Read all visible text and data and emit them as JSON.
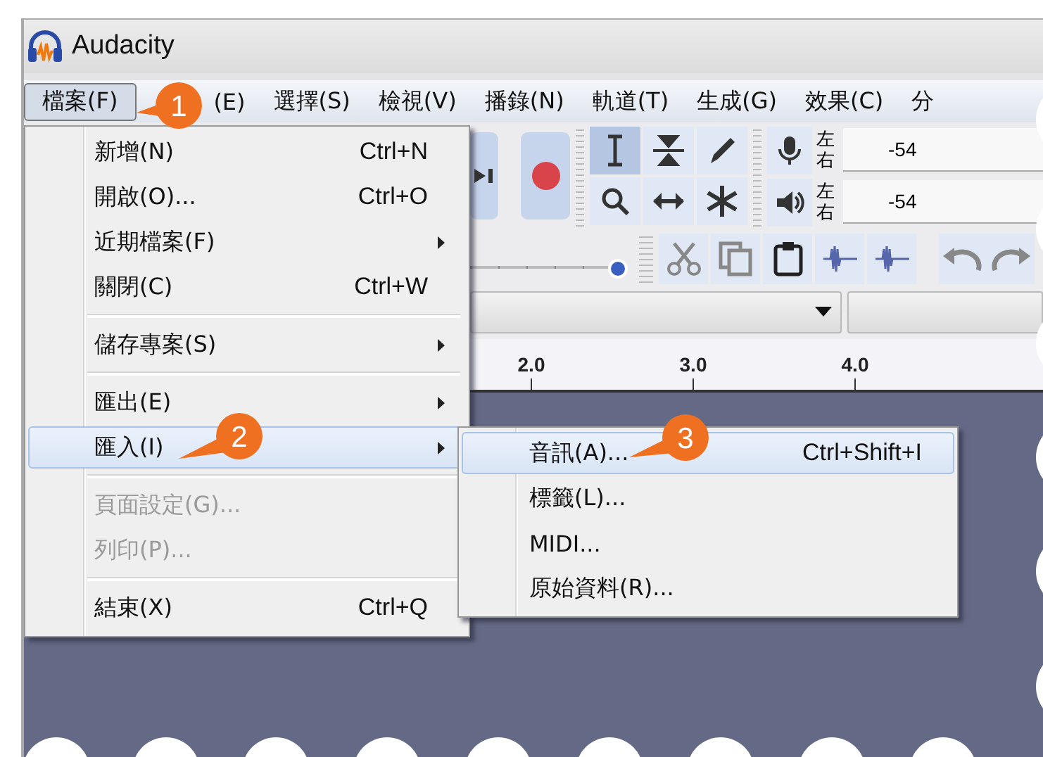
{
  "window": {
    "title": "Audacity"
  },
  "menubar": [
    {
      "label": "檔案(F)",
      "selected": true
    },
    {
      "label": "(E)",
      "selected": false
    },
    {
      "label": "選擇(S)",
      "selected": false
    },
    {
      "label": "檢視(V)",
      "selected": false
    },
    {
      "label": "播錄(N)",
      "selected": false
    },
    {
      "label": "軌道(T)",
      "selected": false
    },
    {
      "label": "生成(G)",
      "selected": false
    },
    {
      "label": "效果(C)",
      "selected": false
    },
    {
      "label": "分",
      "selected": false
    }
  ],
  "tools": [
    {
      "kind": "select",
      "selected": true
    },
    {
      "kind": "envelope",
      "selected": false
    },
    {
      "kind": "draw",
      "selected": false
    },
    {
      "kind": "zoom",
      "selected": false
    },
    {
      "kind": "timeshift",
      "selected": false
    },
    {
      "kind": "multi",
      "selected": false
    }
  ],
  "meters": [
    {
      "kind": "record",
      "left": "左",
      "right": "右",
      "reading": "-54"
    },
    {
      "kind": "playback",
      "left": "左",
      "right": "右",
      "reading": "-54"
    }
  ],
  "ruler": [
    "2.0",
    "3.0",
    "4.0"
  ],
  "volume": {
    "level": 0.95
  },
  "file_menu": [
    {
      "kind": "item",
      "label": "新增(N)",
      "shortcut": "Ctrl+N",
      "submenu": false,
      "selected": false,
      "disabled": false
    },
    {
      "kind": "item",
      "label": "開啟(O)...",
      "shortcut": "Ctrl+O",
      "submenu": false,
      "selected": false,
      "disabled": false
    },
    {
      "kind": "item",
      "label": "近期檔案(F)",
      "submenu": true,
      "selected": false,
      "disabled": false
    },
    {
      "kind": "item",
      "label": "關閉(C)",
      "shortcut": "Ctrl+W",
      "submenu": false,
      "selected": false,
      "disabled": false
    },
    {
      "kind": "separator"
    },
    {
      "kind": "item",
      "label": "儲存專案(S)",
      "submenu": true,
      "selected": false,
      "disabled": false
    },
    {
      "kind": "separator"
    },
    {
      "kind": "item",
      "label": "匯出(E)",
      "submenu": true,
      "selected": false,
      "disabled": false
    },
    {
      "kind": "item",
      "label": "匯入(I)",
      "submenu": true,
      "selected": true,
      "disabled": false
    },
    {
      "kind": "separator"
    },
    {
      "kind": "item",
      "label": "頁面設定(G)...",
      "submenu": false,
      "selected": false,
      "disabled": true
    },
    {
      "kind": "item",
      "label": "列印(P)...",
      "submenu": false,
      "selected": false,
      "disabled": true
    },
    {
      "kind": "separator"
    },
    {
      "kind": "item",
      "label": "結束(X)",
      "shortcut": "Ctrl+Q",
      "submenu": false,
      "selected": false,
      "disabled": false
    }
  ],
  "import_menu": [
    {
      "label": "音訊(A)...",
      "shortcut": "Ctrl+Shift+I",
      "selected": true
    },
    {
      "label": "標籤(L)...",
      "selected": false
    },
    {
      "label": "MIDI...",
      "selected": false
    },
    {
      "label": "原始資料(R)...",
      "selected": false
    }
  ],
  "callouts": [
    "1",
    "2",
    "3"
  ]
}
